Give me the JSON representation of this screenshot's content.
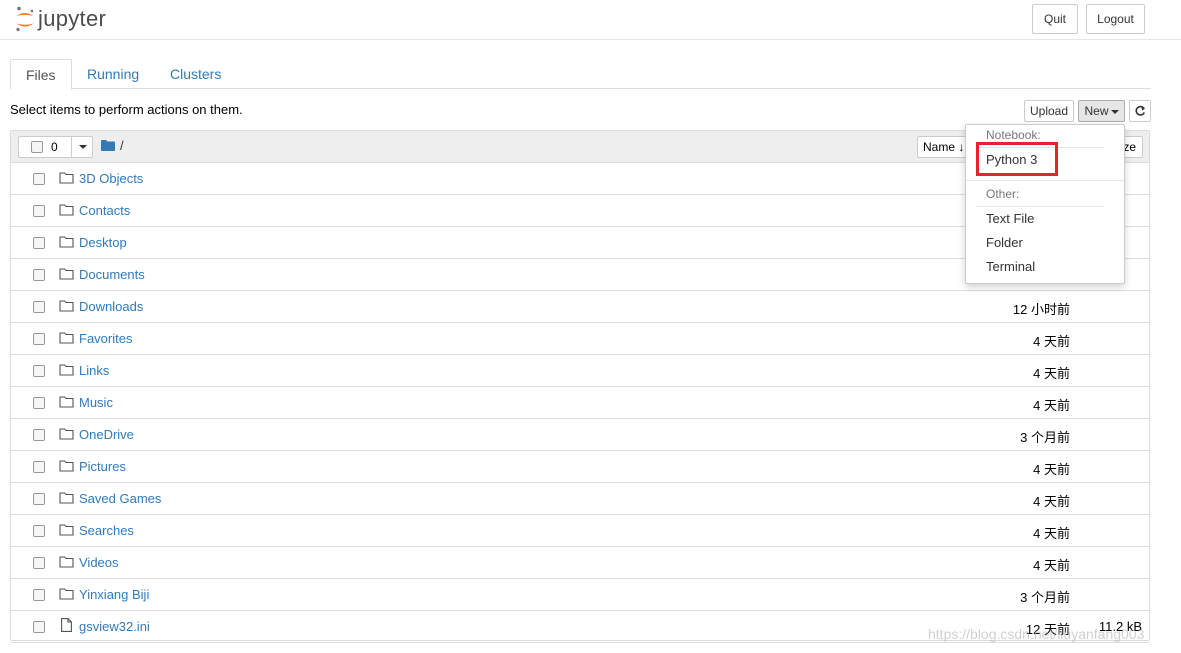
{
  "app": {
    "name": "jupyter"
  },
  "header": {
    "quit_label": "Quit",
    "logout_label": "Logout"
  },
  "tabs": [
    {
      "label": "Files",
      "active": true
    },
    {
      "label": "Running",
      "active": false
    },
    {
      "label": "Clusters",
      "active": false
    }
  ],
  "info_text": "Select items to perform actions on them.",
  "toolbar": {
    "upload_label": "Upload",
    "new_label": "New"
  },
  "list_header": {
    "selected_count": "0",
    "breadcrumb": "/",
    "sort_name_label": "Name",
    "sort_size_label": "ze"
  },
  "new_menu": {
    "notebook_header": "Notebook:",
    "notebook_items": [
      "Python 3"
    ],
    "other_header": "Other:",
    "other_items": [
      "Text File",
      "Folder",
      "Terminal"
    ]
  },
  "rows": [
    {
      "name": "3D Objects",
      "type": "folder",
      "modified": "",
      "size": ""
    },
    {
      "name": "Contacts",
      "type": "folder",
      "modified": "",
      "size": ""
    },
    {
      "name": "Desktop",
      "type": "folder",
      "modified": "",
      "size": ""
    },
    {
      "name": "Documents",
      "type": "folder",
      "modified": "",
      "size": ""
    },
    {
      "name": "Downloads",
      "type": "folder",
      "modified": "12 小时前",
      "size": ""
    },
    {
      "name": "Favorites",
      "type": "folder",
      "modified": "4 天前",
      "size": ""
    },
    {
      "name": "Links",
      "type": "folder",
      "modified": "4 天前",
      "size": ""
    },
    {
      "name": "Music",
      "type": "folder",
      "modified": "4 天前",
      "size": ""
    },
    {
      "name": "OneDrive",
      "type": "folder",
      "modified": "3 个月前",
      "size": ""
    },
    {
      "name": "Pictures",
      "type": "folder",
      "modified": "4 天前",
      "size": ""
    },
    {
      "name": "Saved Games",
      "type": "folder",
      "modified": "4 天前",
      "size": ""
    },
    {
      "name": "Searches",
      "type": "folder",
      "modified": "4 天前",
      "size": ""
    },
    {
      "name": "Videos",
      "type": "folder",
      "modified": "4 天前",
      "size": ""
    },
    {
      "name": "Yinxiang Biji",
      "type": "folder",
      "modified": "3 个月前",
      "size": ""
    },
    {
      "name": "gsview32.ini",
      "type": "file",
      "modified": "12 天前",
      "size": "11.2 kB"
    }
  ],
  "watermark": "https://blog.csdn.net/liuyanfang003",
  "colors": {
    "link": "#337ab7",
    "logo_orange": "#f37726",
    "highlight_box": "#e8232a"
  }
}
